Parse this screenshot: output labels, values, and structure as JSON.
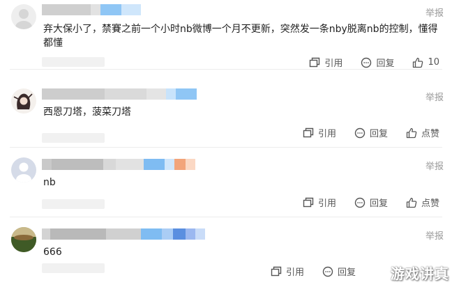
{
  "comments": [
    {
      "text": "弃大保小了，禁賽之前一个小时nb微博一个月不更新，突然发一条nby脱离nb的控制，懂得都懂",
      "report": "举报",
      "quote_label": "引用",
      "reply_label": "回复",
      "like_label": "10"
    },
    {
      "text": "西恩刀塔，菠菜刀塔",
      "report": "举报",
      "quote_label": "引用",
      "reply_label": "回复",
      "like_label": "点赞"
    },
    {
      "text": "nb",
      "report": "举报",
      "quote_label": "引用",
      "reply_label": "回复",
      "like_label": "点赞"
    },
    {
      "text": "666",
      "report": "举报",
      "quote_label": "引用",
      "reply_label": "回复",
      "like_label": ""
    }
  ],
  "watermark": "游戏讲真",
  "colors": {
    "text": "#222222",
    "muted": "#999999",
    "action": "#555555",
    "divider": "#ececec"
  },
  "icons": [
    "quote-icon",
    "reply-icon",
    "like-icon",
    "avatar"
  ]
}
